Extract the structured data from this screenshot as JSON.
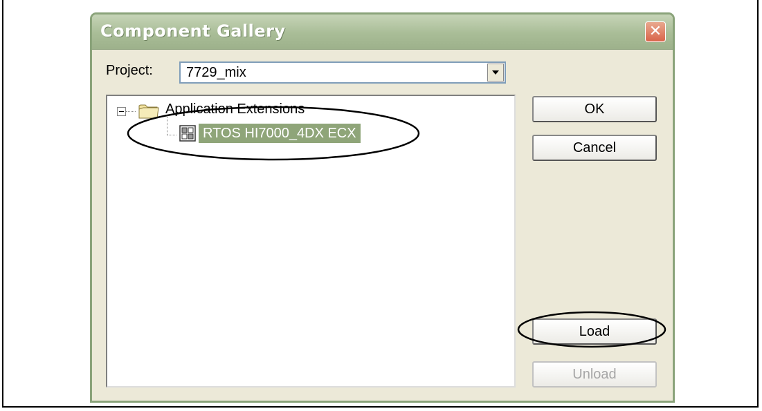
{
  "dialog": {
    "title": "Component Gallery",
    "close_glyph": "✕",
    "project": {
      "label": "Project:",
      "value": "7729_mix"
    },
    "tree": {
      "root": {
        "label": "Application Extensions",
        "icon": "folder-icon",
        "expanded": true,
        "children": [
          {
            "label": "RTOS HI7000_4DX ECX",
            "icon": "component-icon",
            "selected": true
          }
        ]
      }
    },
    "buttons": {
      "ok": "OK",
      "cancel": "Cancel",
      "load": "Load",
      "unload": "Unload"
    }
  },
  "colors": {
    "titlebar": "#a9bd97",
    "selection": "#8fa579",
    "close": "#d9644a",
    "annotation": "#000000"
  }
}
